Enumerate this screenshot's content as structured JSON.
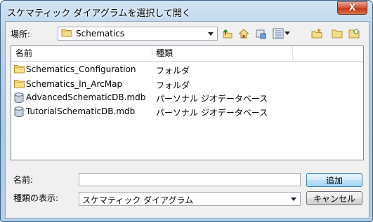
{
  "window": {
    "title": "スケマティック ダイアグラムを選択して開く",
    "close_glyph": "X"
  },
  "look_in": {
    "label": "場所:",
    "value": "Schematics"
  },
  "toolbar": {
    "up_icon": "up-one-level-icon",
    "home_icon": "home-icon",
    "connect_icon": "connect-to-folder-icon",
    "view_icon": "list-view-icon",
    "new_folder_icon": "new-folder-icon",
    "folder_icon": "folder-icon",
    "catalog_icon": "catalog-icon"
  },
  "list": {
    "columns": [
      "名前",
      "種類"
    ],
    "rows": [
      {
        "name": "Schematics_Configuration",
        "type": "フォルダ",
        "icon": "folder-icon"
      },
      {
        "name": "Schematics_In_ArcMap",
        "type": "フォルダ",
        "icon": "folder-icon"
      },
      {
        "name": "AdvancedSchematicDB.mdb",
        "type": "パーソナル ジオデータベース",
        "icon": "database-icon"
      },
      {
        "name": "TutorialSchematicDB.mdb",
        "type": "パーソナル ジオデータベース",
        "icon": "database-icon"
      }
    ]
  },
  "file_name": {
    "label": "名前:",
    "value": ""
  },
  "file_type": {
    "label": "種類の表示:",
    "value": "スケマティック ダイアグラム"
  },
  "buttons": {
    "add": "追加",
    "cancel": "キャンセル"
  },
  "colors": {
    "title_gradient": "#b9d3ea",
    "close_red": "#c23a1a",
    "default_button": "#3c7fb1"
  }
}
